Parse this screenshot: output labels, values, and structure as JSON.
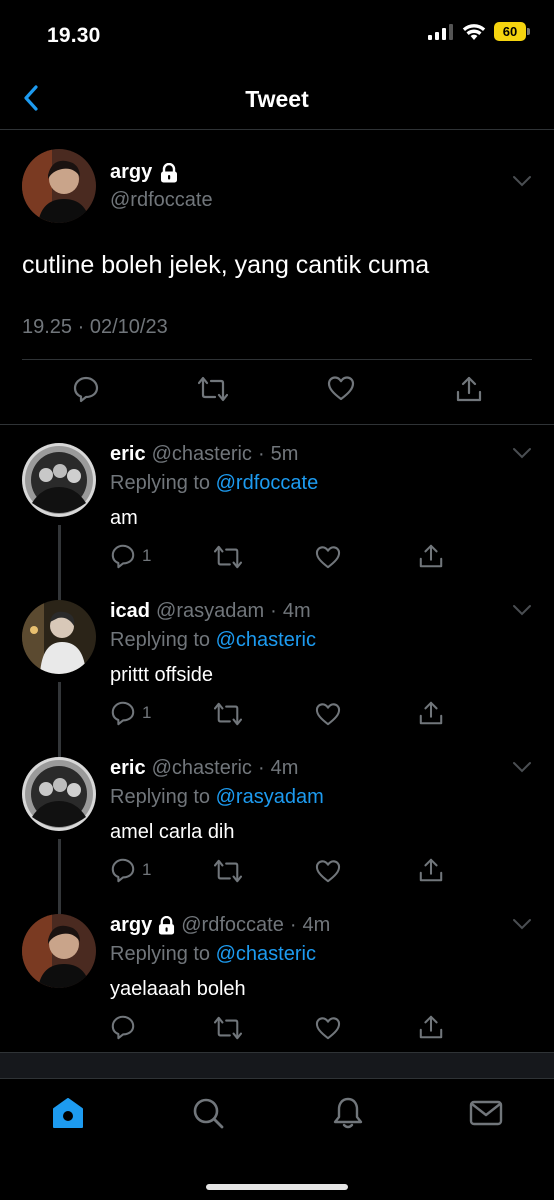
{
  "status_bar": {
    "time": "19.30",
    "battery": "60"
  },
  "header": {
    "title": "Tweet"
  },
  "main_tweet": {
    "name": "argy",
    "handle": "@rdfoccate",
    "text": "cutline boleh jelek, yang cantik cuma",
    "time": "19.25",
    "date": "02/10/23"
  },
  "replies": [
    {
      "name": "eric",
      "handle": "@chasteric",
      "age": "5m",
      "replying_prefix": "Replying to",
      "replying_to": "@rdfoccate",
      "text": "am",
      "reply_count": "1"
    },
    {
      "name": "icad",
      "handle": "@rasyadam",
      "age": "4m",
      "replying_prefix": "Replying to",
      "replying_to": "@chasteric",
      "text": "prittt offside",
      "reply_count": "1"
    },
    {
      "name": "eric",
      "handle": "@chasteric",
      "age": "4m",
      "replying_prefix": "Replying to",
      "replying_to": "@rasyadam",
      "text": "amel carla dih",
      "reply_count": "1"
    },
    {
      "name": "argy",
      "handle": "@rdfoccate",
      "age": "4m",
      "replying_prefix": "Replying to",
      "replying_to": "@chasteric",
      "text": "yaelaaah boleh",
      "reply_count": ""
    }
  ],
  "tabs": [
    "home-icon",
    "search-icon",
    "notifications-icon",
    "messages-icon"
  ],
  "colors": {
    "accent": "#1d9bf0",
    "muted": "#71767b",
    "background": "#000000",
    "battery": "#f5d40f"
  }
}
